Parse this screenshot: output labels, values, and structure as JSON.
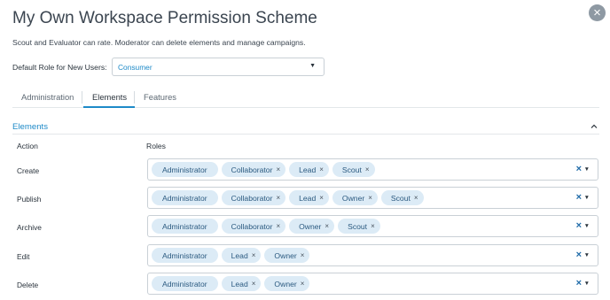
{
  "header": {
    "title": "My Own Workspace Permission Scheme",
    "subtitle": "Scout and Evaluator can rate. Moderator can delete elements and manage campaigns.",
    "close_symbol": "×"
  },
  "default_role": {
    "label": "Default Role for New Users:",
    "value": "Consumer",
    "caret": "▼"
  },
  "tabs": [
    {
      "label": "Administration",
      "active": false
    },
    {
      "label": "Elements",
      "active": true
    },
    {
      "label": "Features",
      "active": false
    }
  ],
  "section": {
    "title": "Elements",
    "collapse_icon": "chevron-up-icon"
  },
  "table": {
    "action_header": "Action",
    "roles_header": "Roles",
    "clear_symbol": "×",
    "caret": "▼",
    "remove_symbol": "×",
    "rows": [
      {
        "action": "Create",
        "roles": [
          "Administrator",
          "Collaborator",
          "Lead",
          "Scout"
        ]
      },
      {
        "action": "Publish",
        "roles": [
          "Administrator",
          "Collaborator",
          "Lead",
          "Owner",
          "Scout"
        ]
      },
      {
        "action": "Archive",
        "roles": [
          "Administrator",
          "Collaborator",
          "Owner",
          "Scout"
        ]
      },
      {
        "action": "Edit",
        "roles": [
          "Administrator",
          "Lead",
          "Owner"
        ]
      },
      {
        "action": "Delete",
        "roles": [
          "Administrator",
          "Lead",
          "Owner"
        ]
      }
    ],
    "fixed_role": "Administrator"
  },
  "colors": {
    "accent": "#1e8ac8",
    "chip_bg": "#dcebf6",
    "close_bg": "#8e99a3"
  }
}
